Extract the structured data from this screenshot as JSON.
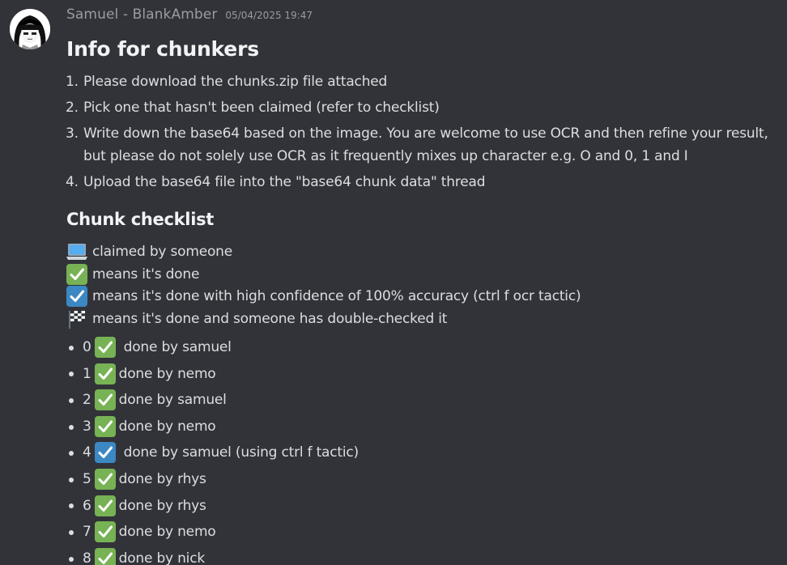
{
  "message": {
    "author": "Samuel - BlankAmber",
    "timestamp": "05/04/2025 19:47",
    "title": "Info for chunkers",
    "steps": [
      "Please download the chunks.zip file attached",
      "Pick one that hasn't been claimed (refer to checklist)",
      "Write down the base64 based on the image. You are welcome to use OCR and then refine your result, but please do not solely use OCR as it frequently mixes up character e.g. O and 0, 1 and I",
      "Upload the base64 file into the \"base64 chunk data\" thread"
    ],
    "checklist_heading": "Chunk checklist",
    "legend": [
      {
        "icon": "laptop-icon",
        "text": "claimed by someone"
      },
      {
        "icon": "green-check-icon",
        "text": "means it's done"
      },
      {
        "icon": "blue-check-icon",
        "text": "means it's done with high confidence of 100% accuracy (ctrl f ocr tactic)"
      },
      {
        "icon": "checkered-flag-icon",
        "text": "means it's done and someone has double-checked it"
      }
    ],
    "chunks": [
      {
        "num": "0",
        "icon": "green-check-icon",
        "text": "done by samuel"
      },
      {
        "num": "1",
        "icon": "green-check-icon",
        "text": "done by nemo"
      },
      {
        "num": "2",
        "icon": "green-check-icon",
        "text": "done by samuel"
      },
      {
        "num": "3",
        "icon": "green-check-icon",
        "text": "done by nemo"
      },
      {
        "num": "4",
        "icon": "blue-check-icon",
        "text": "done by samuel (using ctrl f tactic)"
      },
      {
        "num": "5",
        "icon": "green-check-icon",
        "text": "done by rhys"
      },
      {
        "num": "6",
        "icon": "green-check-icon",
        "text": "done by rhys"
      },
      {
        "num": "7",
        "icon": "green-check-icon",
        "text": "done by nemo"
      },
      {
        "num": "8",
        "icon": "green-check-icon",
        "text": "done by nick"
      }
    ]
  },
  "colors": {
    "background": "#323339",
    "text": "#dbdee1",
    "heading": "#f2f3f5",
    "muted": "#949ba4",
    "green_check": "#77b255",
    "blue_check": "#3b88c3"
  }
}
